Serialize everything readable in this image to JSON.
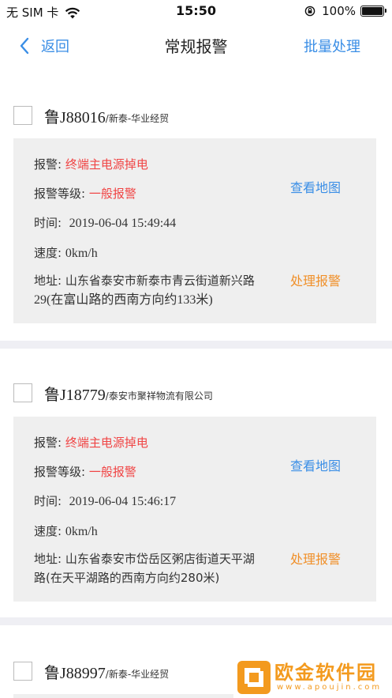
{
  "status_bar": {
    "carrier": "无 SIM 卡",
    "time": "15:50",
    "battery": "100%"
  },
  "nav": {
    "back_label": "返回",
    "title": "常规报警",
    "batch_label": "批量处理"
  },
  "labels": {
    "alarm": "报警:",
    "level": "报警等级:",
    "time": "时间:",
    "speed": "速度:",
    "address": "地址:",
    "view_map": "查看地图",
    "handle_alarm": "处理报警"
  },
  "alarms": [
    {
      "plate": "鲁J88016",
      "company": "/新泰-华业经贸",
      "alarm_type": "终端主电源掉电",
      "level": "一般报警",
      "time": "2019-06-04 15:49:44",
      "speed": "0km/h",
      "address_line1": "山东省泰安市新泰市青云街道新兴路",
      "address_line2": "29(在富山路的西南方向约133米)"
    },
    {
      "plate": "鲁J18779",
      "company": "/泰安市聚祥物流有限公司",
      "alarm_type": "终端主电源掉电",
      "level": "一般报警",
      "time": "2019-06-04 15:46:17",
      "speed": "0km/h",
      "address_line1": "山东省泰安市岱岳区粥店街道天平湖",
      "address_line2": "路(在天平湖路的西南方向约280米)"
    },
    {
      "plate": "鲁J88997",
      "company": "/新泰-华业经贸"
    }
  ],
  "watermark": {
    "name_cn": "欧金软件园",
    "name_en": "www.apoujin.com"
  },
  "colors": {
    "link_blue": "#3a8ee6",
    "alarm_red": "#f04545",
    "handle_orange": "#f0902a",
    "card_gray": "#efefef",
    "separator": "#efeff4"
  }
}
